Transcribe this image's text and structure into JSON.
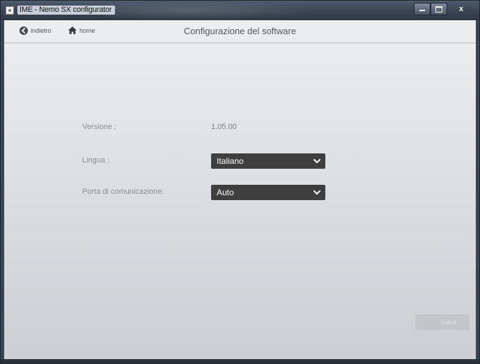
{
  "window": {
    "title": "IME - Nemo SX configurator",
    "controls": {
      "close_label": "x"
    }
  },
  "header": {
    "back_label": "indietro",
    "home_label": "home",
    "page_title": "Configurazione del software"
  },
  "form": {
    "version": {
      "label": "Versione :",
      "value": "1.05.00"
    },
    "language": {
      "label": "Lingua :",
      "selected": "Italiano"
    },
    "port": {
      "label": "Porta di comunicazione:",
      "selected": "Auto"
    }
  },
  "footer": {
    "save_label": "Salva"
  },
  "icons": {
    "back": "back-circle-icon",
    "home": "home-icon",
    "dropdown": "chevron-down-icon",
    "app": "app-icon"
  },
  "colors": {
    "select_bg": "#3f3f3f",
    "client_bg": "#e5e7e9",
    "titlebar": "#3d4857"
  }
}
